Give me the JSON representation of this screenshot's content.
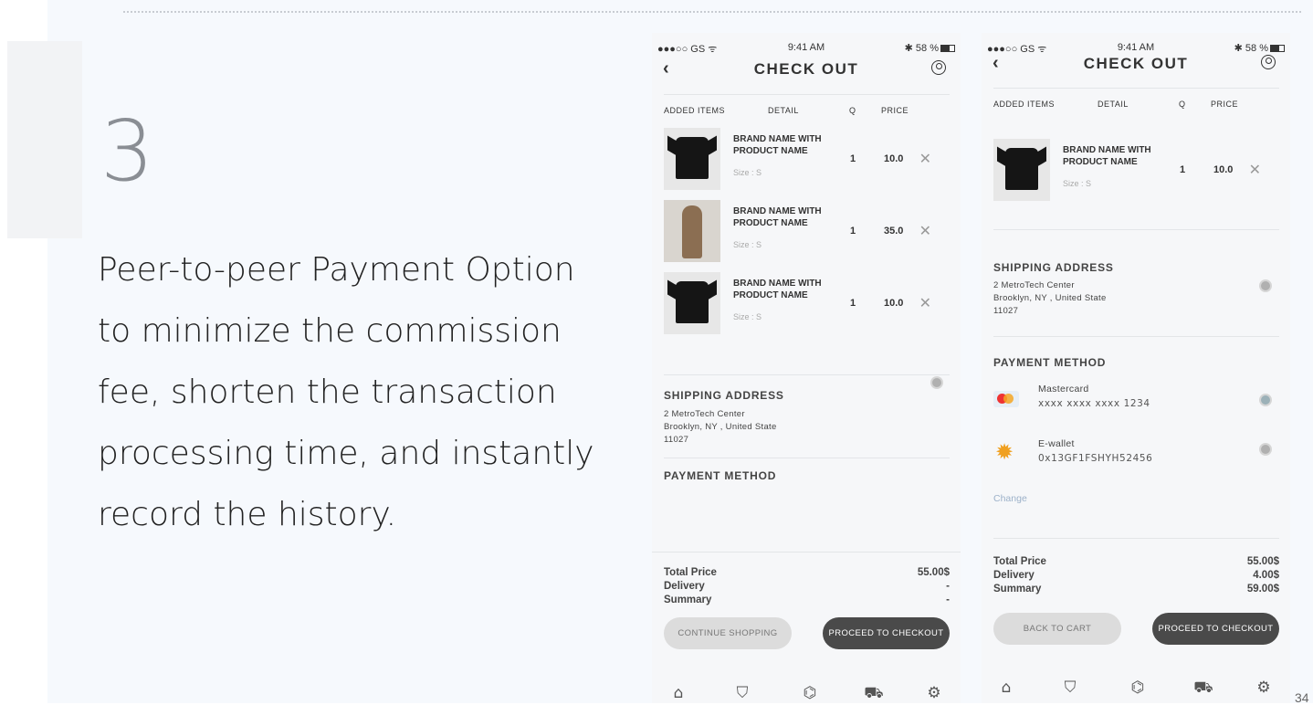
{
  "slide": {
    "step_number": "3",
    "description": "Peer-to-peer Payment Option to minimize the commission fee, shorten the transaction processing time, and instantly record the history.",
    "page_number": "34"
  },
  "screens": [
    {
      "status": {
        "carrier": "●●●○○ GS ᯤ",
        "time": "9:41 AM",
        "battery": "✱ 58 %"
      },
      "title": "CHECK OUT",
      "columns": {
        "items": "ADDED ITEMS",
        "detail": "DETAIL",
        "q": "Q",
        "price": "PRICE"
      },
      "items": [
        {
          "name": "BRAND NAME WITH PRODUCT NAME",
          "size": "Size : S",
          "q": "1",
          "price": "10.0",
          "image": "tshirt"
        },
        {
          "name": "BRAND NAME WITH PRODUCT NAME",
          "size": "Size : S",
          "q": "1",
          "price": "35.0",
          "image": "coat"
        },
        {
          "name": "BRAND NAME WITH PRODUCT NAME",
          "size": "Size : S",
          "q": "1",
          "price": "10.0",
          "image": "tshirt"
        }
      ],
      "shipping": {
        "title": "SHIPPING ADDRESS",
        "line1": "2 MetroTech Center",
        "line2": "Brooklyn, NY , United State",
        "line3": "11027"
      },
      "payment_title": "PAYMENT METHOD",
      "totals": {
        "total_label": "Total Price",
        "delivery_label": "Delivery",
        "summary_label": "Summary",
        "total": "55.00$",
        "delivery": "-",
        "summary": "-"
      },
      "buttons": {
        "left": "CONTINUE SHOPPING",
        "right": "PROCEED TO CHECKOUT"
      }
    },
    {
      "status": {
        "carrier": "●●●○○ GS ᯤ",
        "time": "9:41 AM",
        "battery": "✱ 58 %"
      },
      "title": "CHECK OUT",
      "columns": {
        "items": "ADDED ITEMS",
        "detail": "DETAIL",
        "q": "Q",
        "price": "PRICE"
      },
      "items": [
        {
          "name": "BRAND NAME WITH PRODUCT NAME",
          "size": "Size : S",
          "q": "1",
          "price": "10.0",
          "image": "tshirt"
        }
      ],
      "shipping": {
        "title": "SHIPPING ADDRESS",
        "line1": "2 MetroTech Center",
        "line2": "Brooklyn, NY , United State",
        "line3": "11027"
      },
      "payment_title": "PAYMENT METHOD",
      "payment_methods": [
        {
          "name": "Mastercard",
          "number": "xxxx xxxx xxxx 1234",
          "icon": "mastercard-icon",
          "selected": true
        },
        {
          "name": "E-wallet",
          "number": "0x13GF1FSHYH52456",
          "icon": "ewallet-icon",
          "selected": false
        }
      ],
      "change_label": "Change",
      "totals": {
        "total_label": "Total Price",
        "delivery_label": "Delivery",
        "summary_label": "Summary",
        "total": "55.00$",
        "delivery": "4.00$",
        "summary": "59.00$"
      },
      "buttons": {
        "left": "BACK TO CART",
        "right": "PROCEED TO CHECKOUT"
      }
    }
  ],
  "tabbar_icons": [
    "home-icon",
    "bag-icon",
    "fingerprint-icon",
    "cart-icon",
    "gear-icon"
  ]
}
